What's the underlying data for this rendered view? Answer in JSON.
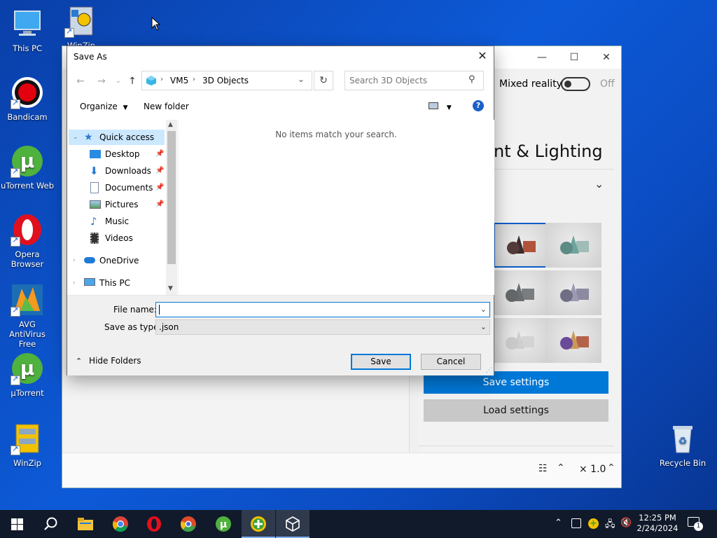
{
  "desktop": {
    "icons": [
      {
        "label": "This PC"
      },
      {
        "label": "Bandicam"
      },
      {
        "label": "uTorrent Web"
      },
      {
        "label": "Opera Browser"
      },
      {
        "label": "AVG AntiVirus Free"
      },
      {
        "label": "µTorrent"
      },
      {
        "label": "WinZip"
      },
      {
        "label": "Recycle Bin"
      }
    ],
    "partial_icon_label": "WinZip"
  },
  "app": {
    "mixed_reality_label": "Mixed reality",
    "mixed_reality_state": "Off",
    "section_title": "nt & Lighting",
    "save_settings": "Save settings",
    "load_settings": "Load settings",
    "zoom": "× 1.0",
    "accent": "#0078d7"
  },
  "dialog": {
    "title": "Save As",
    "breadcrumb": [
      "VM5",
      "3D Objects"
    ],
    "search_placeholder": "Search 3D Objects",
    "organize": "Organize",
    "new_folder": "New folder",
    "nav_items": [
      {
        "label": "Quick access"
      },
      {
        "label": "Desktop"
      },
      {
        "label": "Downloads"
      },
      {
        "label": "Documents"
      },
      {
        "label": "Pictures"
      },
      {
        "label": "Music"
      },
      {
        "label": "Videos"
      },
      {
        "label": "OneDrive"
      },
      {
        "label": "This PC"
      }
    ],
    "empty_message": "No items match your search.",
    "file_name_label": "File name:",
    "file_name_value": "",
    "save_as_type_label": "Save as type:",
    "save_as_type_value": ".json",
    "save": "Save",
    "cancel": "Cancel",
    "hide_folders": "Hide Folders"
  },
  "taskbar": {
    "time": "12:25 PM",
    "date": "2/24/2024",
    "notification_count": "1"
  }
}
